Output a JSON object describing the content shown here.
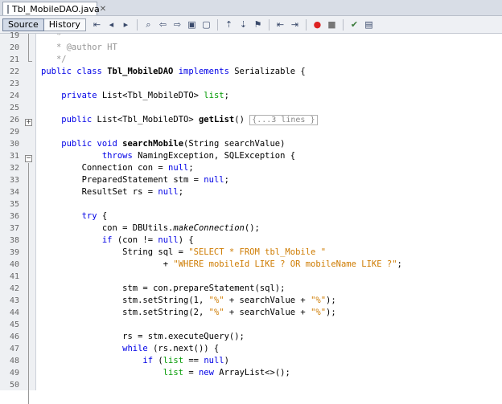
{
  "tab": {
    "filename": "Tbl_MobileDAO.java",
    "close": "✕"
  },
  "toolbar": {
    "source_label": "Source",
    "history_label": "History"
  },
  "code": {
    "lines": [
      {
        "num": "19",
        "segs": [
          {
            "t": "   *",
            "c": "cm"
          }
        ]
      },
      {
        "num": "20",
        "segs": [
          {
            "t": "   * @author HT",
            "c": "cm"
          }
        ]
      },
      {
        "num": "21",
        "segs": [
          {
            "t": "   */",
            "c": "cm"
          }
        ]
      },
      {
        "num": "22",
        "segs": [
          {
            "t": "public class ",
            "c": "kw"
          },
          {
            "t": "Tbl_MobileDAO",
            "c": "b"
          },
          {
            "t": " implements ",
            "c": "kw"
          },
          {
            "t": "Serializable {",
            "c": ""
          }
        ]
      },
      {
        "num": "23",
        "segs": []
      },
      {
        "num": "24",
        "segs": [
          {
            "t": "    private ",
            "c": "kw"
          },
          {
            "t": "List<Tbl_MobileDTO> ",
            "c": ""
          },
          {
            "t": "list",
            "c": "fld"
          },
          {
            "t": ";",
            "c": ""
          }
        ]
      },
      {
        "num": "25",
        "segs": []
      },
      {
        "num": "26",
        "segs": [
          {
            "t": "    public ",
            "c": "kw"
          },
          {
            "t": "List<Tbl_MobileDTO> ",
            "c": ""
          },
          {
            "t": "getList",
            "c": "b"
          },
          {
            "t": "() ",
            "c": ""
          },
          {
            "t": "{...3 lines }",
            "c": "collapsed"
          }
        ]
      },
      {
        "num": "29",
        "segs": []
      },
      {
        "num": "30",
        "segs": [
          {
            "t": "    public void ",
            "c": "kw"
          },
          {
            "t": "searchMobile",
            "c": "b"
          },
          {
            "t": "(String searchValue)",
            "c": ""
          }
        ]
      },
      {
        "num": "31",
        "segs": [
          {
            "t": "            throws ",
            "c": "kw"
          },
          {
            "t": "NamingException, SQLException {",
            "c": ""
          }
        ]
      },
      {
        "num": "32",
        "segs": [
          {
            "t": "        Connection con = ",
            "c": ""
          },
          {
            "t": "null",
            "c": "kw"
          },
          {
            "t": ";",
            "c": ""
          }
        ]
      },
      {
        "num": "33",
        "segs": [
          {
            "t": "        PreparedStatement stm = ",
            "c": ""
          },
          {
            "t": "null",
            "c": "kw"
          },
          {
            "t": ";",
            "c": ""
          }
        ]
      },
      {
        "num": "34",
        "segs": [
          {
            "t": "        ResultSet rs = ",
            "c": ""
          },
          {
            "t": "null",
            "c": "kw"
          },
          {
            "t": ";",
            "c": ""
          }
        ]
      },
      {
        "num": "35",
        "segs": []
      },
      {
        "num": "36",
        "segs": [
          {
            "t": "        try ",
            "c": "kw"
          },
          {
            "t": "{",
            "c": ""
          }
        ]
      },
      {
        "num": "37",
        "segs": [
          {
            "t": "            con = DBUtils.",
            "c": ""
          },
          {
            "t": "makeConnection",
            "c": "it"
          },
          {
            "t": "();",
            "c": ""
          }
        ]
      },
      {
        "num": "38",
        "segs": [
          {
            "t": "            if ",
            "c": "kw"
          },
          {
            "t": "(con != ",
            "c": ""
          },
          {
            "t": "null",
            "c": "kw"
          },
          {
            "t": ") {",
            "c": ""
          }
        ]
      },
      {
        "num": "39",
        "segs": [
          {
            "t": "                String sql = ",
            "c": ""
          },
          {
            "t": "\"SELECT * FROM tbl_Mobile \"",
            "c": "str"
          }
        ]
      },
      {
        "num": "40",
        "segs": [
          {
            "t": "                        + ",
            "c": ""
          },
          {
            "t": "\"WHERE mobileId LIKE ? OR mobileName LIKE ?\"",
            "c": "str"
          },
          {
            "t": ";",
            "c": ""
          }
        ]
      },
      {
        "num": "41",
        "segs": []
      },
      {
        "num": "42",
        "segs": [
          {
            "t": "                stm = con.prepareStatement(sql);",
            "c": ""
          }
        ]
      },
      {
        "num": "43",
        "segs": [
          {
            "t": "                stm.setString(1, ",
            "c": ""
          },
          {
            "t": "\"%\"",
            "c": "str"
          },
          {
            "t": " + searchValue + ",
            "c": ""
          },
          {
            "t": "\"%\"",
            "c": "str"
          },
          {
            "t": ");",
            "c": ""
          }
        ]
      },
      {
        "num": "44",
        "segs": [
          {
            "t": "                stm.setString(2, ",
            "c": ""
          },
          {
            "t": "\"%\"",
            "c": "str"
          },
          {
            "t": " + searchValue + ",
            "c": ""
          },
          {
            "t": "\"%\"",
            "c": "str"
          },
          {
            "t": ");",
            "c": ""
          }
        ]
      },
      {
        "num": "45",
        "segs": []
      },
      {
        "num": "46",
        "segs": [
          {
            "t": "                rs = stm.executeQuery();",
            "c": ""
          }
        ]
      },
      {
        "num": "47",
        "segs": [
          {
            "t": "                while ",
            "c": "kw"
          },
          {
            "t": "(rs.next()) {",
            "c": ""
          }
        ]
      },
      {
        "num": "48",
        "segs": [
          {
            "t": "                    if ",
            "c": "kw"
          },
          {
            "t": "(",
            "c": ""
          },
          {
            "t": "list",
            "c": "fld"
          },
          {
            "t": " == ",
            "c": ""
          },
          {
            "t": "null",
            "c": "kw"
          },
          {
            "t": ")",
            "c": ""
          }
        ]
      },
      {
        "num": "49",
        "segs": [
          {
            "t": "                        ",
            "c": ""
          },
          {
            "t": "list",
            "c": "fld"
          },
          {
            "t": " = ",
            "c": ""
          },
          {
            "t": "new ",
            "c": "kw"
          },
          {
            "t": "ArrayList<>();",
            "c": ""
          }
        ]
      },
      {
        "num": "50",
        "segs": []
      }
    ]
  }
}
